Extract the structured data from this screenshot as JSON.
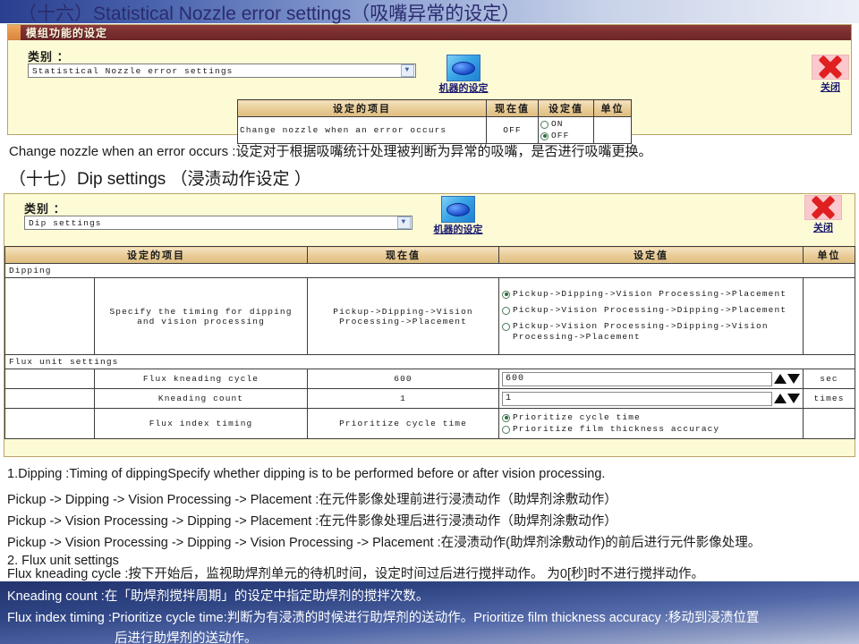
{
  "header": {
    "title": "（十六）Statistical Nozzle error settings（吸嘴异常的设定）"
  },
  "panel1": {
    "titlebar": "模组功能的设定",
    "category_label": "类别 ：",
    "category_value": "Statistical Nozzle error settings",
    "machine_button_label": "机器的设定",
    "close_button_label": "关闭",
    "table": {
      "columns": [
        "设定的项目",
        "现在值",
        "设定值",
        "单位"
      ],
      "rows": [
        {
          "item": "Change nozzle when an error occurs",
          "current": "OFF",
          "options": [
            {
              "label": "ON",
              "selected": false
            },
            {
              "label": "OFF",
              "selected": true
            }
          ],
          "unit": ""
        }
      ]
    }
  },
  "mid": {
    "desc": "Change nozzle when an error occurs :设定对于根据吸嘴统计处理被判断为异常的吸嘴，是否进行吸嘴更换。",
    "section_title": "（十七）Dip settings （浸渍动作设定 ）"
  },
  "panel2": {
    "category_label": "类别 ：",
    "category_value": "Dip settings",
    "machine_button_label": "机器的设定",
    "close_button_label": "关闭",
    "table": {
      "columns": [
        "设定的项目",
        "现在值",
        "设定值",
        "单位"
      ],
      "groups": [
        {
          "name": "Dipping",
          "rows": [
            {
              "item": "Specify the timing for dipping and vision processing",
              "current": "Pickup->Dipping->Vision Processing->Placement",
              "options": [
                {
                  "label": "Pickup->Dipping->Vision Processing->Placement",
                  "selected": true
                },
                {
                  "label": "Pickup->Vision Processing->Dipping->Placement",
                  "selected": false
                },
                {
                  "label": "Pickup->Vision Processing->Dipping->Vision Processing->Placement",
                  "selected": false
                }
              ],
              "unit": ""
            }
          ]
        },
        {
          "name": "Flux unit settings",
          "rows": [
            {
              "item": "Flux kneading cycle",
              "current": "600",
              "input": "600",
              "unit": "sec"
            },
            {
              "item": "Kneading count",
              "current": "1",
              "input": "1",
              "unit": "times"
            },
            {
              "item": "Flux index timing",
              "current": "Prioritize cycle time",
              "options": [
                {
                  "label": "Prioritize cycle time",
                  "selected": true
                },
                {
                  "label": "Prioritize film thickness accuracy",
                  "selected": false
                }
              ],
              "unit": ""
            }
          ]
        }
      ]
    }
  },
  "notes": {
    "light": [
      "1.Dipping :Timing of dippingSpecify whether dipping is to be performed before or after vision processing.",
      "Pickup -> Dipping -> Vision Processing -> Placement :在元件影像处理前进行浸渍动作（助焊剂涂敷动作）",
      "Pickup -> Vision Processing -> Dipping -> Placement :在元件影像处理后进行浸渍动作（助焊剂涂敷动作）",
      "Pickup -> Vision Processing -> Dipping -> Vision Processing -> Placement :在浸渍动作(助焊剂涂敷动作)的前后进行元件影像处理。",
      "2. Flux unit settings",
      "Flux kneading cycle :按下开始后，监视助焊剂单元的待机时间，设定时间过后进行搅拌动作。 为0[秒]时不进行搅拌动作。"
    ],
    "dark": [
      "Kneading count :在「助焊剂搅拌周期」的设定中指定助焊剂的搅拌次数。",
      "Flux index timing :Prioritize cycle time:判断为有浸渍的时候进行助焊剂的送动作。Prioritize film thickness accuracy :移动到浸渍位置",
      "后进行助焊剂的送动作。"
    ]
  },
  "colors": {
    "banner_start": "#2a3f8f",
    "panel_bg": "#fdfbd6",
    "panel_border": "#b9a46a",
    "titlebar": "#7a2e2e",
    "titlebar_accent": "#e89a4e",
    "table_header": "#e8cb95",
    "close_red": "#e02020",
    "machine_blue": "#1849c8",
    "radio_green": "#2f6b3f",
    "dark_note_bg": "#2f4584"
  }
}
